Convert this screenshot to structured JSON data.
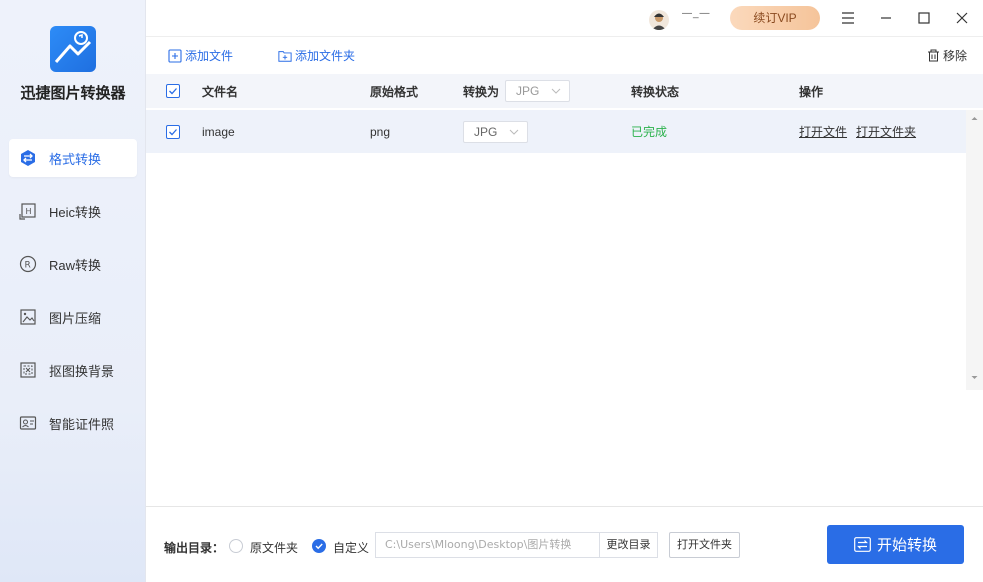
{
  "app": {
    "name": "迅捷图片转换器"
  },
  "sidebar": {
    "items": [
      {
        "label": "格式转换",
        "icon": "format-convert-icon",
        "active": true
      },
      {
        "label": "Heic转换",
        "icon": "heic-icon"
      },
      {
        "label": "Raw转换",
        "icon": "raw-icon"
      },
      {
        "label": "图片压缩",
        "icon": "image-compress-icon"
      },
      {
        "label": "抠图换背景",
        "icon": "cutout-icon"
      },
      {
        "label": "智能证件照",
        "icon": "id-photo-icon"
      }
    ]
  },
  "titlebar": {
    "username": "―_―",
    "vip_label": "续订VIP"
  },
  "toolbar": {
    "add_file": "添加文件",
    "add_folder": "添加文件夹",
    "remove": "移除"
  },
  "table": {
    "headers": {
      "filename": "文件名",
      "original_format": "原始格式",
      "convert_to": "转换为",
      "convert_to_value": "JPG",
      "status": "转换状态",
      "actions": "操作"
    },
    "rows": [
      {
        "filename": "image",
        "original_format": "png",
        "target_format": "JPG",
        "status": "已完成",
        "action_open_file": "打开文件",
        "action_open_folder": "打开文件夹"
      }
    ]
  },
  "footer": {
    "output_label": "输出目录：",
    "option_source": "原文件夹",
    "option_custom": "自定义",
    "path": "C:\\Users\\Mloong\\Desktop\\图片转换",
    "change_dir": "更改目录",
    "open_folder": "打开文件夹",
    "start": "开始转换"
  },
  "colors": {
    "accent": "#2a6de6",
    "success": "#2bb24c",
    "vip": "#f5c49a"
  }
}
